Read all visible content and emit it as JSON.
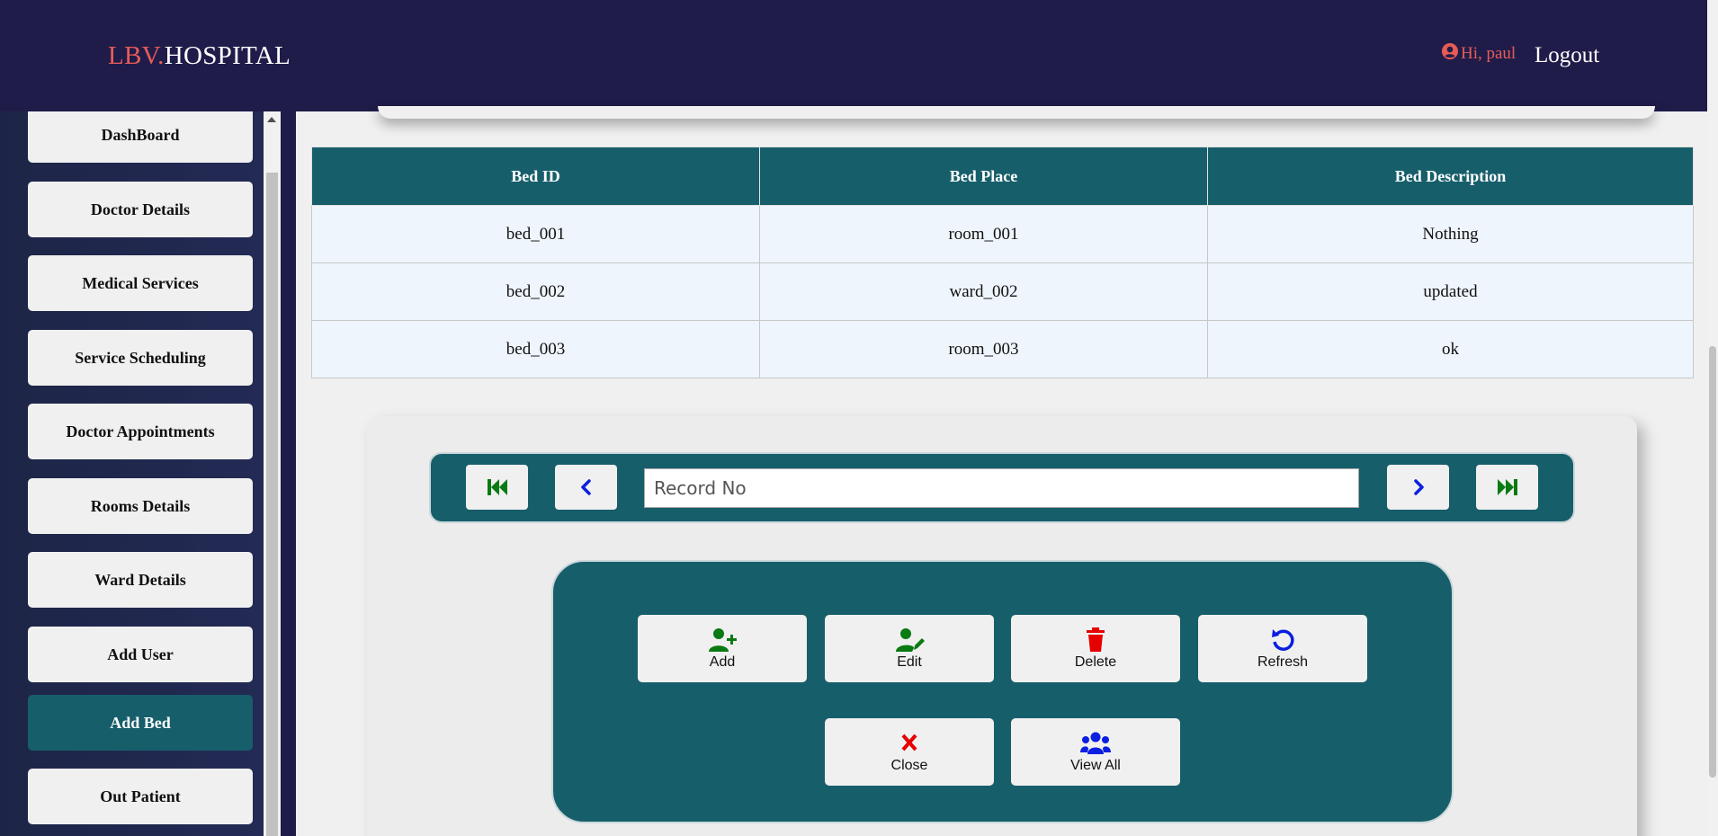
{
  "header": {
    "brand_prefix": "LBV.",
    "brand_suffix": "HOSPITAL",
    "greeting": "Hi, paul",
    "logout_label": "Logout"
  },
  "sidebar": {
    "items": [
      {
        "label": "DashBoard",
        "active": false
      },
      {
        "label": "Doctor Details",
        "active": false
      },
      {
        "label": "Medical Services",
        "active": false
      },
      {
        "label": "Service Scheduling",
        "active": false
      },
      {
        "label": "Doctor Appointments",
        "active": false
      },
      {
        "label": "Rooms Details",
        "active": false
      },
      {
        "label": "Ward Details",
        "active": false
      },
      {
        "label": "Add User",
        "active": false
      },
      {
        "label": "Add Bed",
        "active": true
      },
      {
        "label": "Out Patient",
        "active": false
      }
    ]
  },
  "table": {
    "headers": [
      "Bed ID",
      "Bed Place",
      "Bed Description"
    ],
    "rows": [
      [
        "bed_001",
        "room_001",
        "Nothing"
      ],
      [
        "bed_002",
        "ward_002",
        "updated"
      ],
      [
        "bed_003",
        "room_003",
        "ok"
      ]
    ]
  },
  "record_nav": {
    "placeholder": "Record No",
    "value": ""
  },
  "actions": {
    "add": "Add",
    "edit": "Edit",
    "delete": "Delete",
    "refresh": "Refresh",
    "close": "Close",
    "view_all": "View All"
  },
  "icons": {
    "first": "first-record-icon",
    "prev": "previous-record-icon",
    "next": "next-record-icon",
    "last": "last-record-icon",
    "add": "user-plus-icon",
    "edit": "user-edit-icon",
    "delete": "trash-icon",
    "refresh": "refresh-icon",
    "close": "close-icon",
    "view_all": "users-icon"
  },
  "colors": {
    "header_bg": "#1f1c4a",
    "brand_accent": "#e85c56",
    "teal": "#175e6b",
    "green_icon": "#0a7a13",
    "red_icon": "#e60000",
    "blue_icon": "#0b1fe0"
  }
}
